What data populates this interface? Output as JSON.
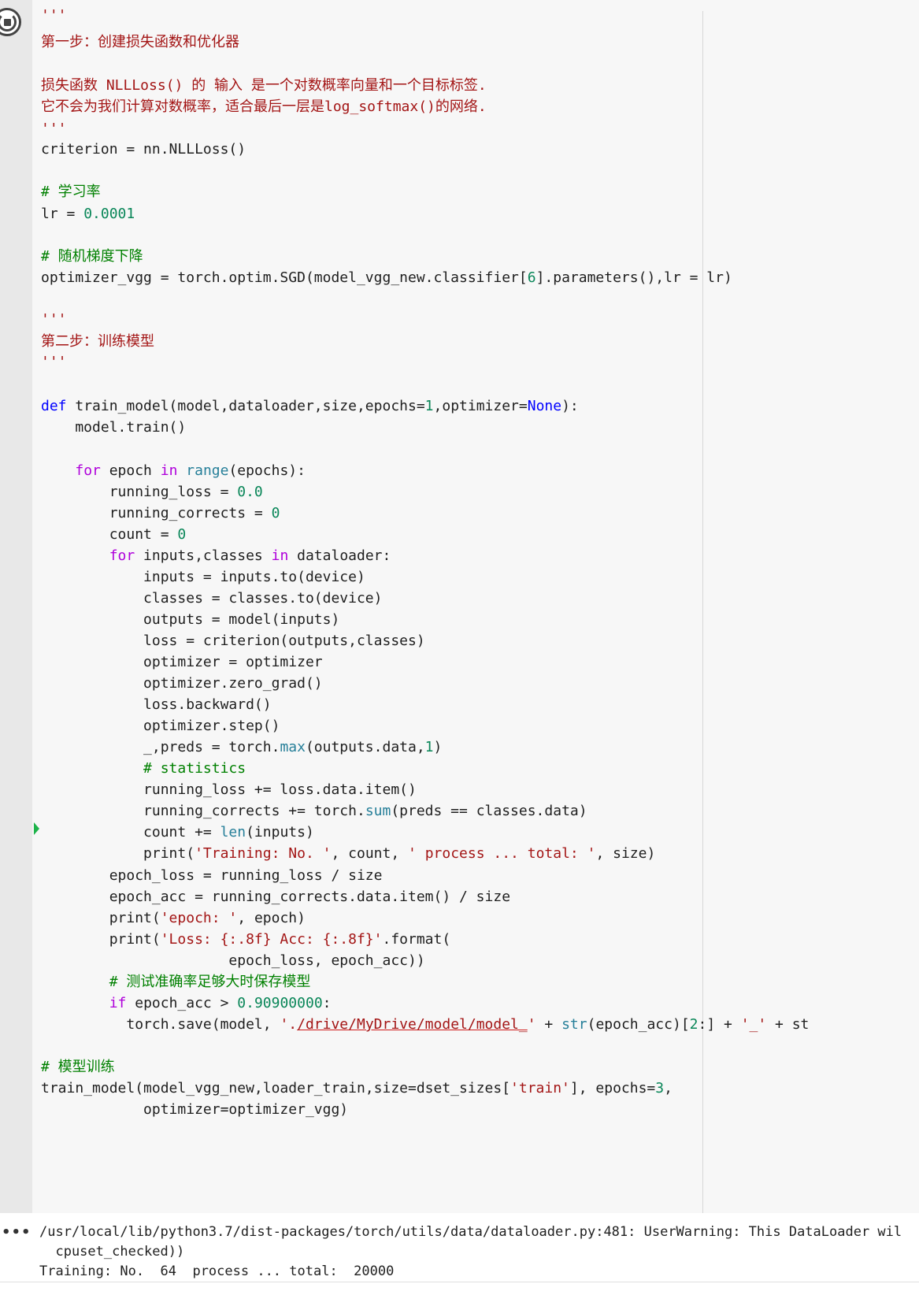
{
  "code_lines": [
    "'''",
    "第一步：创建损失函数和优化器",
    "",
    "损失函数 NLLLoss() 的 输入 是一个对数概率向量和一个目标标签.",
    "它不会为我们计算对数概率，适合最后一层是log_softmax()的网络.",
    "'''",
    "criterion = nn.NLLLoss()",
    "",
    "# 学习率",
    "lr = 0.0001",
    "",
    "# 随机梯度下降",
    "optimizer_vgg = torch.optim.SGD(model_vgg_new.classifier[6].parameters(),lr = lr)",
    "",
    "'''",
    "第二步：训练模型",
    "'''",
    "",
    "def train_model(model,dataloader,size,epochs=1,optimizer=None):",
    "    model.train()",
    "",
    "    for epoch in range(epochs):",
    "        running_loss = 0.0",
    "        running_corrects = 0",
    "        count = 0",
    "        for inputs,classes in dataloader:",
    "            inputs = inputs.to(device)",
    "            classes = classes.to(device)",
    "            outputs = model(inputs)",
    "            loss = criterion(outputs,classes)",
    "            optimizer = optimizer",
    "            optimizer.zero_grad()",
    "            loss.backward()",
    "            optimizer.step()",
    "            _,preds = torch.max(outputs.data,1)",
    "            # statistics",
    "            running_loss += loss.data.item()",
    "            running_corrects += torch.sum(preds == classes.data)",
    "            count += len(inputs)",
    "            print('Training: No. ', count, ' process ... total: ', size)",
    "        epoch_loss = running_loss / size",
    "        epoch_acc = running_corrects.data.item() / size",
    "        print('epoch: ', epoch)",
    "        print('Loss: {:.8f} Acc: {:.8f}'.format(",
    "                      epoch_loss, epoch_acc))",
    "        # 测试准确率足够大时保存模型",
    "        if epoch_acc > 0.90900000:",
    "          torch.save(model, './drive/MyDrive/model/model_' + str(epoch_acc)[2:] + '_' + st",
    "",
    "# 模型训练",
    "train_model(model_vgg_new,loader_train,size=dset_sizes['train'], epochs=3,",
    "            optimizer=optimizer_vgg)"
  ],
  "output": {
    "lines": [
      "/usr/local/lib/python3.7/dist-packages/torch/utils/data/dataloader.py:481: UserWarning: This DataLoader wil",
      "  cpuset_checked))",
      "Training: No.  64  process ... total:  20000"
    ],
    "menu_icon": "ellipsis-icon"
  },
  "icons": {
    "run": "stop-run-icon",
    "exec_marker": "execution-marker-icon"
  },
  "colors": {
    "string": "#a31515",
    "comment": "#008000",
    "keyword": "#0000ff",
    "control_keyword": "#af00db",
    "number": "#098658",
    "function": "#795e26",
    "builtin": "#267f99",
    "cell_background": "#f7f7f7",
    "gutter": "#e8e8e8",
    "exec_marker": "#1db34a"
  }
}
